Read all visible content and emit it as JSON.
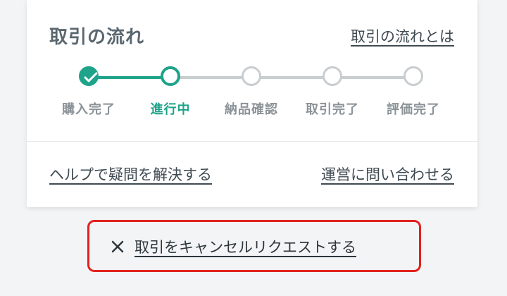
{
  "flow": {
    "title": "取引の流れ",
    "about_link": "取引の流れとは",
    "steps": [
      {
        "label": "購入完了",
        "state": "done"
      },
      {
        "label": "進行中",
        "state": "current"
      },
      {
        "label": "納品確認",
        "state": "pending"
      },
      {
        "label": "取引完了",
        "state": "pending"
      },
      {
        "label": "評価完了",
        "state": "pending"
      }
    ],
    "accent_color": "#1fa38a",
    "inactive_color": "#c8cdd0"
  },
  "footer_links": {
    "help": "ヘルプで疑問を解決する",
    "contact": "運営に問い合わせる"
  },
  "cancel": {
    "icon": "close-icon",
    "label": "取引をキャンセルリクエストする",
    "highlight_color": "#e0221f"
  }
}
